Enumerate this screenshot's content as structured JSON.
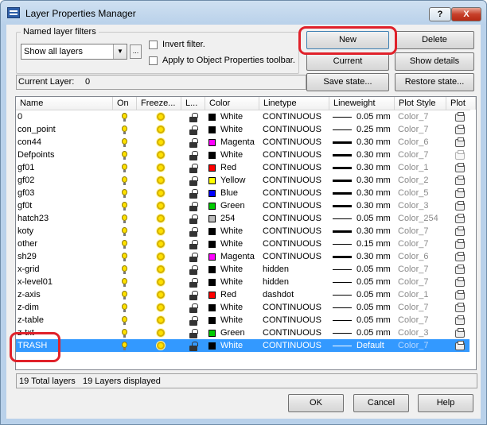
{
  "window": {
    "title": "Layer Properties Manager"
  },
  "titlebar": {
    "help_label": "?",
    "close_label": "X"
  },
  "filters": {
    "group_label": "Named layer filters",
    "selected": "Show all layers",
    "more_label": "...",
    "invert_label": "Invert filter.",
    "apply_label": "Apply to Object Properties toolbar."
  },
  "buttons": {
    "new": "New",
    "delete": "Delete",
    "current": "Current",
    "show_details": "Show details",
    "save_state": "Save state...",
    "restore_state": "Restore state...",
    "ok": "OK",
    "cancel": "Cancel",
    "help": "Help"
  },
  "current_layer": {
    "label": "Current Layer:",
    "value": "0"
  },
  "columns": [
    "Name",
    "On",
    "Freeze...",
    "L...",
    "Color",
    "Linetype",
    "Lineweight",
    "Plot Style",
    "Plot"
  ],
  "layers": [
    {
      "name": "0",
      "color": "White",
      "color_hex": "#000000",
      "linetype": "CONTINUOUS",
      "lineweight": "0.05 mm",
      "thick": false,
      "plot_style": "Color_7",
      "plot_enabled": true
    },
    {
      "name": "con_point",
      "color": "White",
      "color_hex": "#000000",
      "linetype": "CONTINUOUS",
      "lineweight": "0.25 mm",
      "thick": false,
      "plot_style": "Color_7",
      "plot_enabled": true
    },
    {
      "name": "con44",
      "color": "Magenta",
      "color_hex": "#ff00ff",
      "linetype": "CONTINUOUS",
      "lineweight": "0.30 mm",
      "thick": true,
      "plot_style": "Color_6",
      "plot_enabled": true
    },
    {
      "name": "Defpoints",
      "color": "White",
      "color_hex": "#000000",
      "linetype": "CONTINUOUS",
      "lineweight": "0.30 mm",
      "thick": true,
      "plot_style": "Color_7",
      "plot_enabled": false
    },
    {
      "name": "gf01",
      "color": "Red",
      "color_hex": "#ff0000",
      "linetype": "CONTINUOUS",
      "lineweight": "0.30 mm",
      "thick": true,
      "plot_style": "Color_1",
      "plot_enabled": true
    },
    {
      "name": "gf02",
      "color": "Yellow",
      "color_hex": "#ffff00",
      "linetype": "CONTINUOUS",
      "lineweight": "0.30 mm",
      "thick": true,
      "plot_style": "Color_2",
      "plot_enabled": true
    },
    {
      "name": "gf03",
      "color": "Blue",
      "color_hex": "#0000ff",
      "linetype": "CONTINUOUS",
      "lineweight": "0.30 mm",
      "thick": true,
      "plot_style": "Color_5",
      "plot_enabled": true
    },
    {
      "name": "gf0t",
      "color": "Green",
      "color_hex": "#00cc00",
      "linetype": "CONTINUOUS",
      "lineweight": "0.30 mm",
      "thick": true,
      "plot_style": "Color_3",
      "plot_enabled": true
    },
    {
      "name": "hatch23",
      "color": "254",
      "color_hex": "#bdbdbd",
      "linetype": "CONTINUOUS",
      "lineweight": "0.05 mm",
      "thick": false,
      "plot_style": "Color_254",
      "plot_enabled": true
    },
    {
      "name": "koty",
      "color": "White",
      "color_hex": "#000000",
      "linetype": "CONTINUOUS",
      "lineweight": "0.30 mm",
      "thick": true,
      "plot_style": "Color_7",
      "plot_enabled": true
    },
    {
      "name": "other",
      "color": "White",
      "color_hex": "#000000",
      "linetype": "CONTINUOUS",
      "lineweight": "0.15 mm",
      "thick": false,
      "plot_style": "Color_7",
      "plot_enabled": true
    },
    {
      "name": "sh29",
      "color": "Magenta",
      "color_hex": "#ff00ff",
      "linetype": "CONTINUOUS",
      "lineweight": "0.30 mm",
      "thick": true,
      "plot_style": "Color_6",
      "plot_enabled": true
    },
    {
      "name": "x-grid",
      "color": "White",
      "color_hex": "#000000",
      "linetype": "hidden",
      "lineweight": "0.05 mm",
      "thick": false,
      "plot_style": "Color_7",
      "plot_enabled": true
    },
    {
      "name": "x-level01",
      "color": "White",
      "color_hex": "#000000",
      "linetype": "hidden",
      "lineweight": "0.05 mm",
      "thick": false,
      "plot_style": "Color_7",
      "plot_enabled": true
    },
    {
      "name": "z-axis",
      "color": "Red",
      "color_hex": "#ff0000",
      "linetype": "dashdot",
      "lineweight": "0.05 mm",
      "thick": false,
      "plot_style": "Color_1",
      "plot_enabled": true
    },
    {
      "name": "z-dim",
      "color": "White",
      "color_hex": "#000000",
      "linetype": "CONTINUOUS",
      "lineweight": "0.05 mm",
      "thick": false,
      "plot_style": "Color_7",
      "plot_enabled": true
    },
    {
      "name": "z-table",
      "color": "White",
      "color_hex": "#000000",
      "linetype": "CONTINUOUS",
      "lineweight": "0.05 mm",
      "thick": false,
      "plot_style": "Color_7",
      "plot_enabled": true
    },
    {
      "name": "z-txt",
      "color": "Green",
      "color_hex": "#00cc00",
      "linetype": "CONTINUOUS",
      "lineweight": "0.05 mm",
      "thick": false,
      "plot_style": "Color_3",
      "plot_enabled": true
    },
    {
      "name": "TRASH",
      "color": "White",
      "color_hex": "#000000",
      "linetype": "CONTINUOUS",
      "lineweight": "Default",
      "thick": false,
      "plot_style": "Color_7",
      "plot_enabled": true,
      "selected": true
    }
  ],
  "status": {
    "total": "19 Total layers",
    "displayed": "19 Layers displayed"
  },
  "colors": {
    "highlight": "#e0212a",
    "selection": "#3399ff",
    "accent": "#3c7fb1"
  },
  "icons": {
    "on": "lightbulb-icon",
    "freeze": "sun-icon",
    "lock": "unlocked-padlock-icon",
    "plot": "printer-icon"
  }
}
